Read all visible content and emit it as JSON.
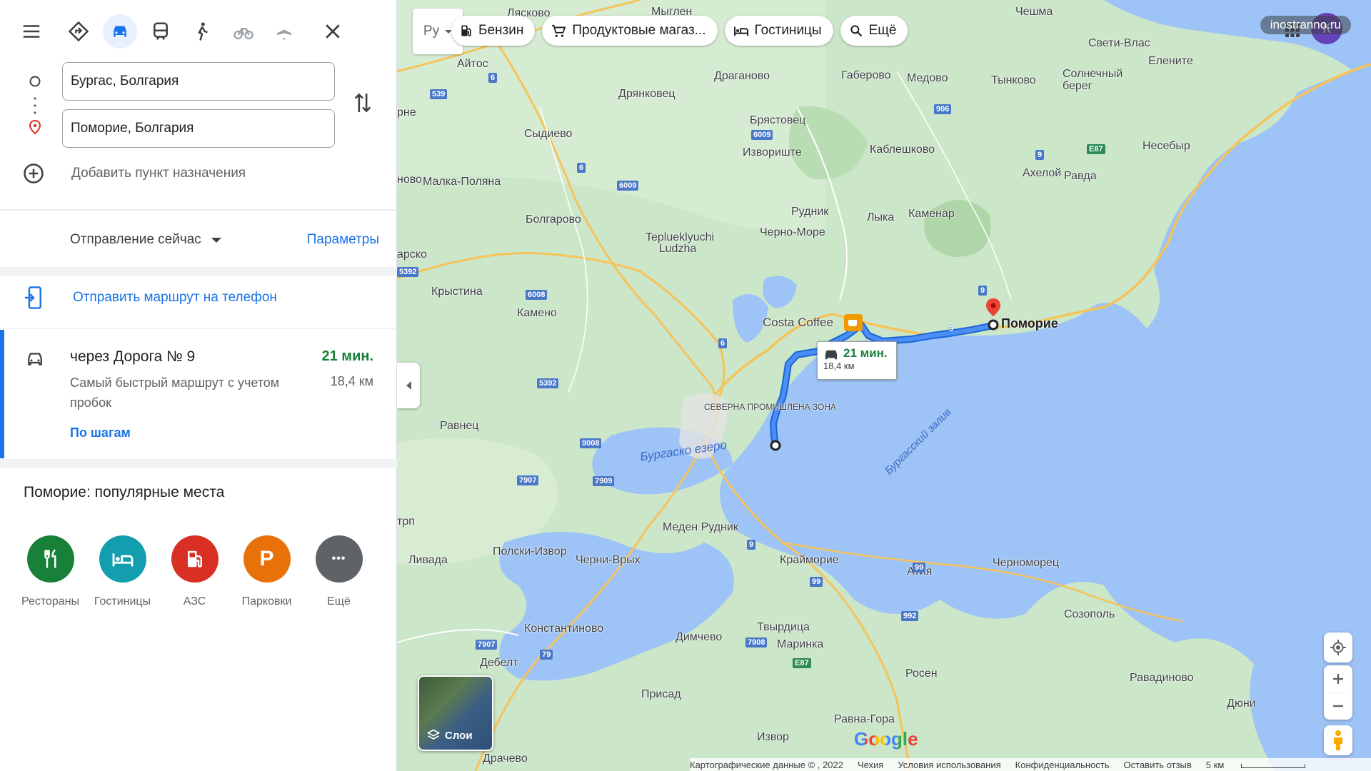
{
  "travel_modes": [
    {
      "name": "Маршрут",
      "icon": "directions-icon"
    },
    {
      "name": "На автомобиле",
      "icon": "car-icon",
      "active": true
    },
    {
      "name": "Общественный транспорт",
      "icon": "train-icon"
    },
    {
      "name": "Пешком",
      "icon": "walk-icon"
    },
    {
      "name": "На велосипеде",
      "icon": "bike-icon"
    },
    {
      "name": "Авиарейсы",
      "icon": "plane-icon"
    }
  ],
  "origin": {
    "value": "Бургас, Болгария"
  },
  "destination": {
    "value": "Поморие, Болгария"
  },
  "add_destination": "Добавить пункт назначения",
  "departure": {
    "label": "Отправление сейчас",
    "params": "Параметры"
  },
  "send_to_phone": "Отправить маршрут на телефон",
  "route": {
    "title": "через Дорога № 9",
    "time": "21 мин.",
    "distance": "18,4 км",
    "description": "Самый быстрый маршрут с учетом пробок",
    "steps": "По шагам"
  },
  "popular": {
    "title": "Поморие: популярные места",
    "categories": [
      {
        "label": "Рестораны",
        "icon": "restaurant-icon",
        "color": "#188038"
      },
      {
        "label": "Гостиницы",
        "icon": "hotel-icon",
        "color": "#129eaf"
      },
      {
        "label": "АЗС",
        "icon": "gas-station-icon",
        "color": "#d93025"
      },
      {
        "label": "Парковки",
        "icon": "parking-icon",
        "color": "#e8710a",
        "glyph": "P"
      },
      {
        "label": "Ещё",
        "icon": "more-icon",
        "color": "#5f6368",
        "glyph": "•••"
      }
    ]
  },
  "map": {
    "lang_box": "Ру",
    "chips": [
      {
        "label": "Бензин",
        "icon": "gas-icon"
      },
      {
        "label": "Продуктовые магаз...",
        "icon": "cart-icon"
      },
      {
        "label": "Гостиницы",
        "icon": "bed-icon"
      },
      {
        "label": "Ещё",
        "icon": "search-icon"
      }
    ],
    "watermark": "inostranno.ru",
    "avatar_letter": "К",
    "callout": {
      "time": "21 мин.",
      "distance": "18,4 км"
    },
    "layers_label": "Слои",
    "google": "Google",
    "footer": [
      "Картографические данные © , 2022",
      "Чехия",
      "Условия использования",
      "Конфиденциальность",
      "Оставить отзыв",
      "5 км"
    ],
    "labels": {
      "pomorie": "Поморие",
      "costa": "Costa Coffee",
      "burgas_lake": "Бургаско езеро",
      "burgas_bay": "Бургасский залив",
      "sev_zona": "СЕВЕРНА ПРОМИШЛЕНА ЗОНА",
      "aitos": "Айтос",
      "mygren": "Мыглен",
      "lyaskovo": "Лясково",
      "chesma": "Чешма",
      "sveti_vlas": "Свети-Влас",
      "elenite": "Елените",
      "draganovo": "Драганово",
      "gaberovo": "Габерово",
      "medovo": "Медово",
      "tynkovo": "Тынково",
      "solnechny": "Солнечный берег",
      "dryankovets": "Дрянковец",
      "bryastovets": "Брястовец",
      "sydievo": "Сыдиево",
      "izvorishte": "Извориште",
      "kableshkovo": "Каблешково",
      "nesebar": "Несебыр",
      "aheloy": "Ахелой",
      "ravda": "Равда",
      "malka_polyana": "Малка-Поляна",
      "bolgarovo": "Болгарово",
      "rudnik": "Рудник",
      "cherno_more": "Черно-Море",
      "lyka": "Лыка",
      "kamenar": "Каменар",
      "teplu": "Teplueklyuchi Ludzha",
      "krystina": "Крыстина",
      "kameno": "Камено",
      "ravnets": "Равнец",
      "meden_rudnik": "Меден Рудник",
      "livada": "Ливада",
      "polski_izvor": "Полски-Извор",
      "cherni_vrah": "Черни-Врых",
      "kraimorie": "Крайморие",
      "atia": "Атия",
      "chernomorets": "Черноморец",
      "sozopol": "Созополь",
      "konstantinovo": "Константиново",
      "dimchevo": "Димчево",
      "tvyrditsa": "Твырдица",
      "marinka": "Маринка",
      "debelt": "Дебелт",
      "prisad": "Присад",
      "rosen": "Росен",
      "ravadinovo": "Равадиново",
      "dyuni": "Дюни",
      "ravna_gora": "Равна-Гора",
      "izvor": "Извор",
      "drachevo": "Драчево",
      "trp": "трп",
      "rsko": "арско",
      "nvo": "ново",
      "rne": "рне"
    },
    "shields": [
      "539",
      "6",
      "6009",
      "6",
      "6009",
      "906",
      "9",
      "E87",
      "5392",
      "6008",
      "6",
      "5392",
      "9008",
      "7907",
      "7909",
      "9",
      "99",
      "99",
      "992",
      "79",
      "7907",
      "7908",
      "E87",
      "9",
      "9"
    ]
  },
  "colors": {
    "accent": "#1a73e8",
    "route": "#1a73e8",
    "time": "#188038",
    "water": "#9ec3f6",
    "land": "#cfe8cf",
    "road": "#f6c35a"
  }
}
